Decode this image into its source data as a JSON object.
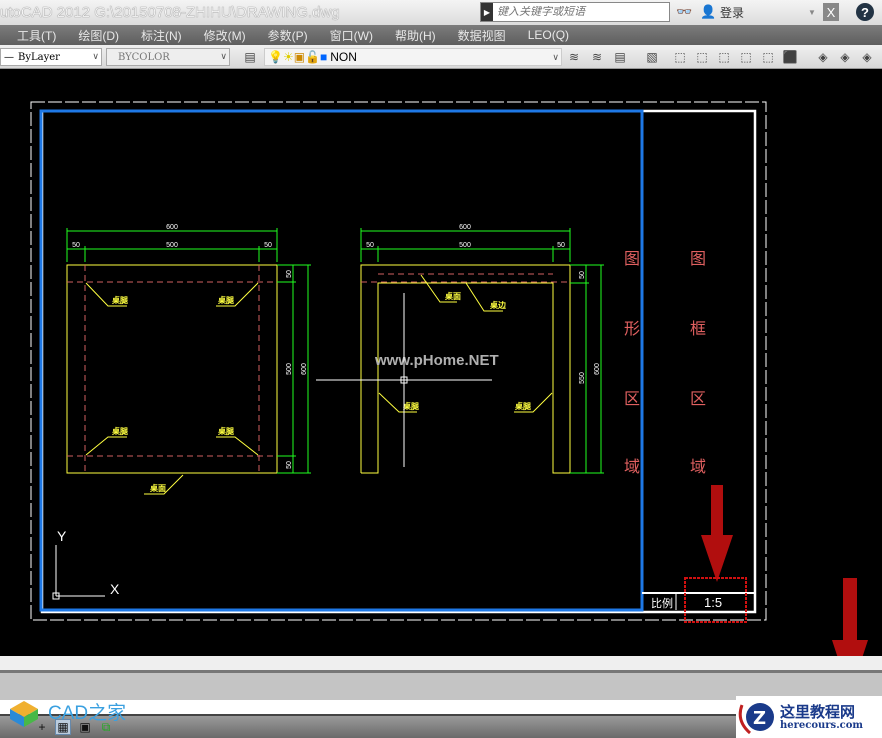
{
  "titlebar": {
    "title": "utoCAD 2012    G:\\20150708-ZHIHU\\DRAWING.dwg",
    "search_placeholder": "键入关键字或短语",
    "login": "登录"
  },
  "menu": [
    "工具(T)",
    "绘图(D)",
    "标注(N)",
    "修改(M)",
    "参数(P)",
    "窗口(W)",
    "帮助(H)",
    "数据视图",
    "LEO(Q)"
  ],
  "toolbar": {
    "linetype": "ByLayer",
    "lineweight": "BYCOLOR",
    "layer": "NON"
  },
  "drawing": {
    "left_view": {
      "dims_top": [
        "600",
        "50",
        "500",
        "50"
      ],
      "dims_right": [
        "50",
        "500",
        "50",
        "600"
      ],
      "labels": [
        "桌腿",
        "桌腿",
        "桌腿",
        "桌腿",
        "桌面"
      ]
    },
    "right_view": {
      "dims_top": [
        "600",
        "50",
        "500",
        "50"
      ],
      "dims_right": [
        "50",
        "550",
        "600"
      ],
      "labels": [
        "桌面",
        "桌边",
        "桌腿",
        "桌腿"
      ]
    },
    "watermark": "www.pHome.NET",
    "ucs": {
      "x": "X",
      "y": "Y"
    },
    "region_graphics": [
      "图",
      "形",
      "区",
      "域"
    ],
    "region_frame": [
      "图",
      "框",
      "区",
      "域"
    ],
    "title_block": {
      "scale_label": "比例",
      "scale_value": "1:5"
    }
  },
  "logos": {
    "cad": "CAD之家",
    "here_cn": "这里教程网",
    "here_en": "herecours.com"
  },
  "colors": {
    "yellow": "#ffff40",
    "green": "#20ff20",
    "red": "#e05a5a",
    "blue": "#1e78e6"
  }
}
